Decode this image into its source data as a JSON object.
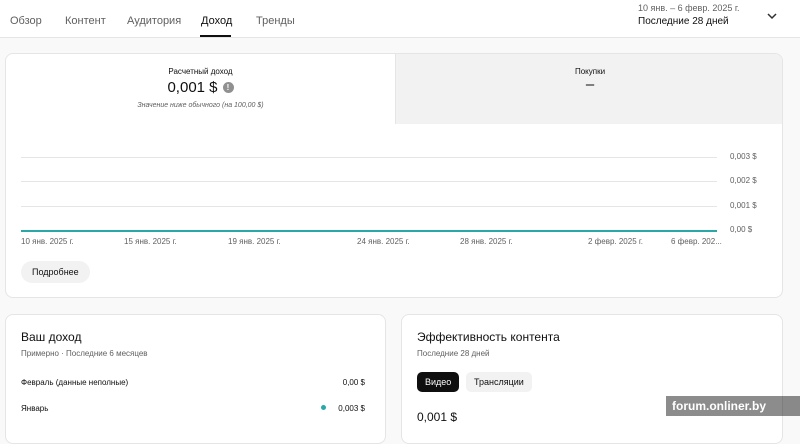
{
  "tabs": [
    {
      "label": "Обзор",
      "active": false
    },
    {
      "label": "Контент",
      "active": false
    },
    {
      "label": "Аудитория",
      "active": false
    },
    {
      "label": "Доход",
      "active": true
    },
    {
      "label": "Тренды",
      "active": false
    }
  ],
  "date_picker": {
    "range": "10 янв. – 6 февр. 2025 г.",
    "label": "Последние 28 дней",
    "icon": "chevron-down-icon"
  },
  "revenue_card": {
    "metric_title": "Расчетный доход",
    "metric_value": "0,001 $",
    "metric_note": "Значение ниже обычного (на 100,00 $)",
    "info_icon": "info-icon",
    "purchases_title": "Покупки",
    "purchases_value": "–",
    "more_button": "Подробнее"
  },
  "chart_data": {
    "type": "line",
    "y_tick_labels": [
      "0,003 $",
      "0,002 $",
      "0,001 $",
      "0,00 $"
    ],
    "x_tick_labels": [
      "10 янв. 2025 г.",
      "15 янв. 2025 г.",
      "19 янв. 2025 г.",
      "24 янв. 2025 г.",
      "28 янв. 2025 г.",
      "2 февр. 2025 г.",
      "6 февр. 202..."
    ],
    "ylim": [
      0,
      0.003
    ],
    "series": [
      {
        "values": [
          0,
          0,
          0,
          0,
          0,
          0,
          0
        ]
      }
    ],
    "grid": true,
    "line_color": "#2aa8a8"
  },
  "income_card": {
    "title": "Ваш доход",
    "subtitle": "Примерно · Последние 6 месяцев",
    "rows": [
      {
        "label": "Февраль (данные неполные)",
        "value": "0,00 $"
      },
      {
        "label": "Январь",
        "value": "0,003 $"
      }
    ]
  },
  "performance_card": {
    "title": "Эффективность контента",
    "subtitle": "Последние 28 дней",
    "chips": [
      {
        "label": "Видео",
        "active": true
      },
      {
        "label": "Трансляции",
        "active": false
      }
    ],
    "value": "0,001 $"
  },
  "watermark": "forum.onliner.by"
}
